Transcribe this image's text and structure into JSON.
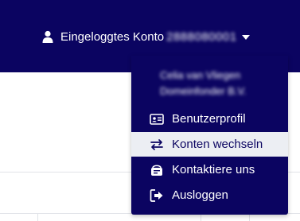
{
  "header": {
    "account_label": "Eingeloggtes Konto",
    "account_id": "2888080001",
    "user_icon": "user-icon",
    "caret_icon": "chevron-down-icon"
  },
  "dropdown": {
    "company_line_1": "Celia van Vliegen",
    "company_line_2": "Domeinfonder B.V.",
    "items": [
      {
        "label": "Benutzerprofil",
        "icon": "id-card-icon"
      },
      {
        "label": "Konten wechseln",
        "icon": "switch-arrows-icon"
      },
      {
        "label": "Kontaktiere uns",
        "icon": "contact-icon"
      },
      {
        "label": "Ausloggen",
        "icon": "logout-icon"
      }
    ]
  },
  "colors": {
    "navbar": "#0b0461",
    "active_item_bg": "#eceef3"
  }
}
